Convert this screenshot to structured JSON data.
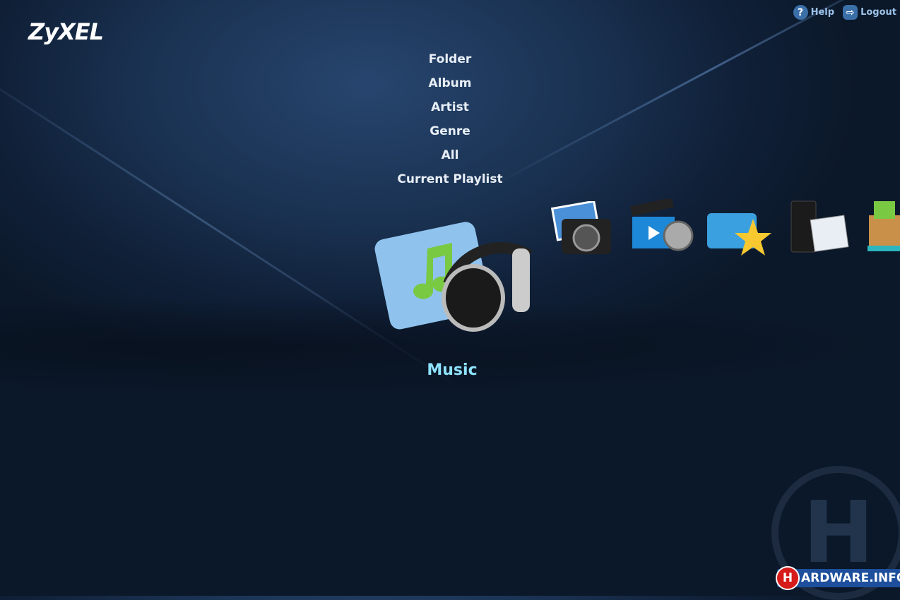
{
  "brand": {
    "logo": "ZyXEL"
  },
  "header": {
    "help": "Help",
    "help_icon": "question-icon",
    "logout": "Logout",
    "logout_icon": "logout-icon"
  },
  "menu": {
    "items": [
      "Folder",
      "Album",
      "Artist",
      "Genre",
      "All",
      "Current Playlist"
    ]
  },
  "carousel": {
    "selected": "Music",
    "items": [
      "music",
      "photo",
      "video",
      "favorites",
      "nas-web",
      "download"
    ]
  },
  "watermark": {
    "text": "HARDWARE.INFO"
  },
  "colors": {
    "accent": "#8fe3ff",
    "link": "#9cc1e8"
  }
}
